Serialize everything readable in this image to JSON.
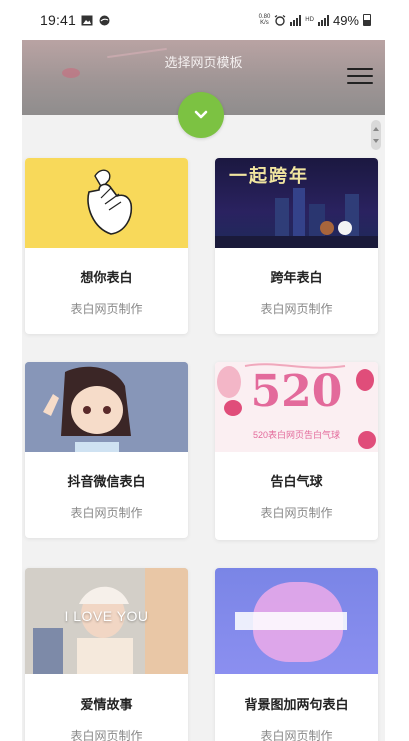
{
  "status_bar": {
    "time": "19:41",
    "net_speed_top": "0.80",
    "net_speed_bottom": "K/s",
    "hd": "HD",
    "battery": "49%"
  },
  "header": {
    "title": "选择网页模板"
  },
  "templates": [
    {
      "title": "想你表白",
      "subtitle": "表白网页制作"
    },
    {
      "title": "跨年表白",
      "subtitle": "表白网页制作",
      "thumb_text": "一起跨年"
    },
    {
      "title": "抖音微信表白",
      "subtitle": "表白网页制作"
    },
    {
      "title": "告白气球",
      "subtitle": "表白网页制作",
      "thumb_big": "520",
      "thumb_small": "520表白网页告白气球"
    },
    {
      "title": "爱情故事",
      "subtitle": "表白网页制作",
      "thumb_text": "I LOVE YOU"
    },
    {
      "title": "背景图加两句表白",
      "subtitle": "表白网页制作"
    }
  ],
  "colors": {
    "accent": "#7cc242",
    "card_title": "#222222",
    "card_sub": "#888888",
    "page_bg": "#f2f2f2"
  },
  "icons": {
    "toggle": "chevron-down-icon",
    "menu": "hamburger-menu-icon"
  }
}
